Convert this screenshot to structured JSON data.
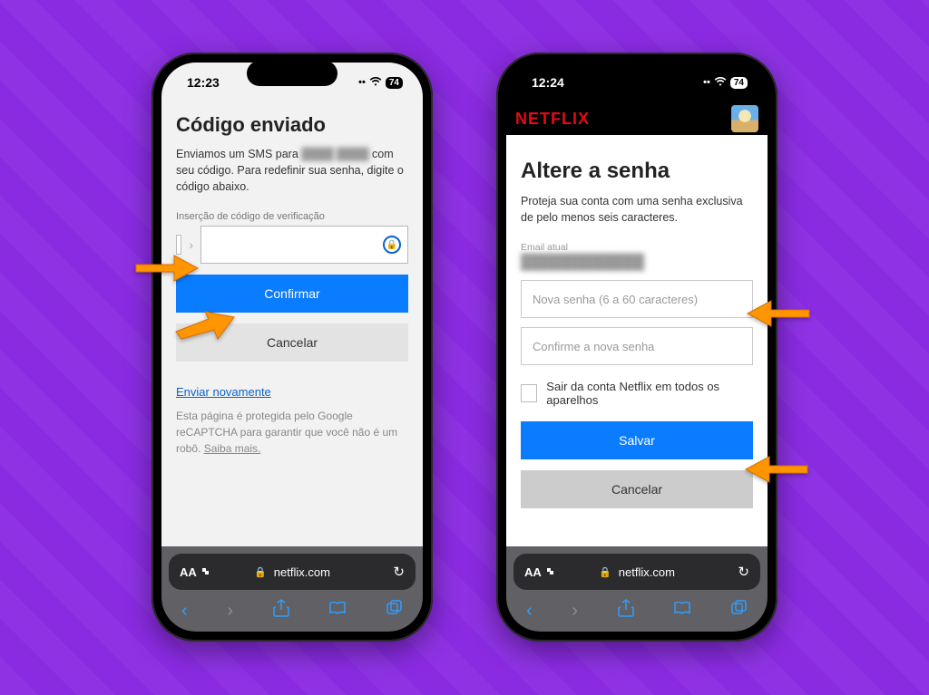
{
  "phone1": {
    "status_time": "12:23",
    "battery": "74",
    "wifi_icon": "wifi",
    "title": "Código enviado",
    "desc_prefix": "Enviamos um SMS para ",
    "desc_masked": "████ ████",
    "desc_suffix": " com seu código. Para redefinir sua senha, digite o código abaixo.",
    "field_label": "Inserção de código de verificação",
    "confirm_label": "Confirmar",
    "cancel_label": "Cancelar",
    "resend_link": "Enviar novamente",
    "recaptcha_text": "Esta página é protegida pelo Google reCAPTCHA para garantir que você não é um robô. ",
    "recaptcha_more": "Saiba mais.",
    "url_text": "netflix.com",
    "aa_label": "AA"
  },
  "phone2": {
    "status_time": "12:24",
    "battery": "74",
    "netflix_logo": "NETFLIX",
    "title": "Altere a senha",
    "desc": "Proteja sua conta com uma senha exclusiva de pelo menos seis caracteres.",
    "email_label": "Email atual",
    "new_password_placeholder": "Nova senha (6 a 60 caracteres)",
    "confirm_password_placeholder": "Confirme a nova senha",
    "checkbox_label": "Sair da conta Netflix em todos os aparelhos",
    "save_label": "Salvar",
    "cancel_label": "Cancelar",
    "url_text": "netflix.com",
    "aa_label": "AA"
  }
}
